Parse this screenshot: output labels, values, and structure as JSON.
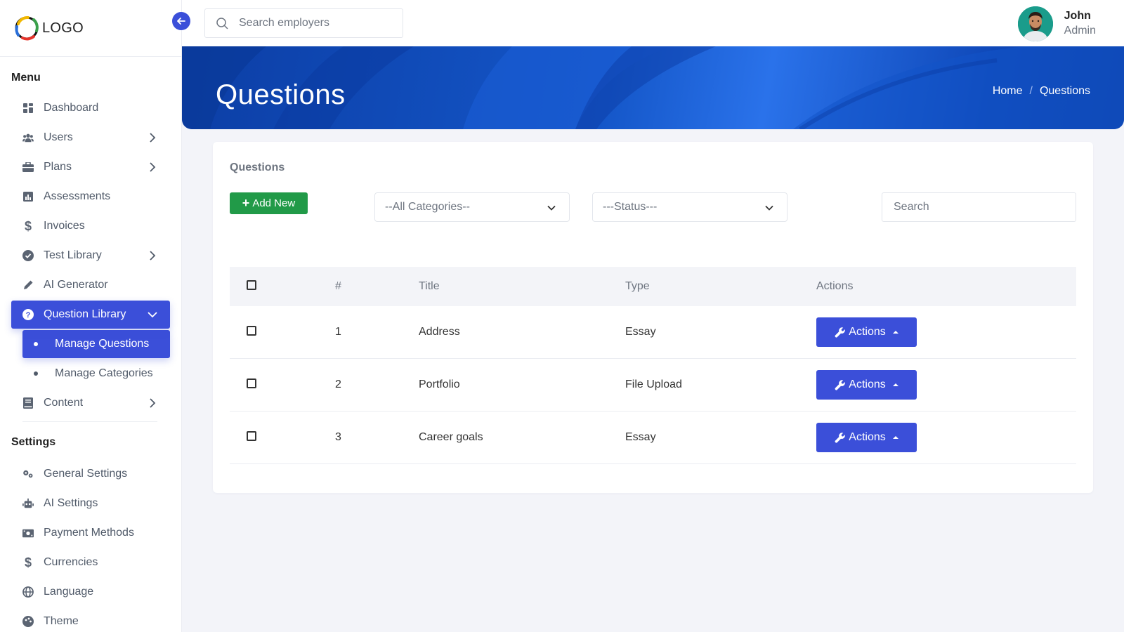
{
  "logo": {
    "text": "LOGO"
  },
  "search": {
    "placeholder": "Search employers"
  },
  "user": {
    "name": "John",
    "role": "Admin"
  },
  "sidebar": {
    "menu_title": "Menu",
    "items": [
      {
        "label": "Dashboard",
        "icon": "dashboard-icon",
        "chevron": false
      },
      {
        "label": "Users",
        "icon": "users-icon",
        "chevron": true
      },
      {
        "label": "Plans",
        "icon": "briefcase-icon",
        "chevron": true
      },
      {
        "label": "Assessments",
        "icon": "bar-chart-icon",
        "chevron": false
      },
      {
        "label": "Invoices",
        "icon": "dollar-icon",
        "chevron": false
      },
      {
        "label": "Test Library",
        "icon": "check-circle-icon",
        "chevron": true
      },
      {
        "label": "AI Generator",
        "icon": "pencil-icon",
        "chevron": false
      },
      {
        "label": "Question Library",
        "icon": "question-circle-icon",
        "chevron": true,
        "expanded": true,
        "active": true
      },
      {
        "label": "Content",
        "icon": "book-icon",
        "chevron": true
      }
    ],
    "sub_items": [
      {
        "label": "Manage Questions",
        "active": true
      },
      {
        "label": "Manage Categories",
        "active": false
      }
    ],
    "settings_title": "Settings",
    "settings_items": [
      {
        "label": "General Settings",
        "icon": "gears-icon"
      },
      {
        "label": "AI Settings",
        "icon": "robot-icon"
      },
      {
        "label": "Payment Methods",
        "icon": "money-bill-icon"
      },
      {
        "label": "Currencies",
        "icon": "dollar-icon"
      },
      {
        "label": "Language",
        "icon": "globe-icon"
      },
      {
        "label": "Theme",
        "icon": "palette-icon"
      }
    ]
  },
  "banner": {
    "title": "Questions",
    "breadcrumb": {
      "home": "Home",
      "separator": "/",
      "current": "Questions"
    }
  },
  "card": {
    "title": "Questions",
    "add_button": "Add New",
    "category_select": "--All Categories--",
    "status_select": "---Status---",
    "search_placeholder": "Search"
  },
  "table": {
    "headers": {
      "number": "#",
      "title": "Title",
      "type": "Type",
      "actions": "Actions"
    },
    "rows": [
      {
        "number": "1",
        "title": "Address",
        "type": "Essay",
        "action": "Actions"
      },
      {
        "number": "2",
        "title": "Portfolio",
        "type": "File Upload",
        "action": "Actions"
      },
      {
        "number": "3",
        "title": "Career goals",
        "type": "Essay",
        "action": "Actions"
      }
    ]
  },
  "colors": {
    "primary": "#3b4fd9",
    "success": "#219a48",
    "banner": "#1456c8",
    "background": "#f3f4f9"
  }
}
